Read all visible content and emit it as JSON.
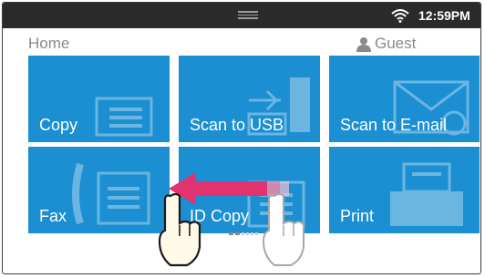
{
  "status_bar": {
    "time": "12:59PM",
    "wifi_icon": "wifi-icon",
    "handle_icon": "drag-handle-icon"
  },
  "header": {
    "title": "Home",
    "user_label": "Guest",
    "user_icon": "person-icon"
  },
  "tiles": [
    {
      "label": "Copy",
      "icon": "copy-icon"
    },
    {
      "label": "Scan to USB",
      "icon": "usb-icon"
    },
    {
      "label": "Scan to E-mail",
      "icon": "email-icon"
    },
    {
      "label": "Fax",
      "icon": "fax-icon"
    },
    {
      "label": "ID Copy",
      "icon": "id-copy-icon"
    },
    {
      "label": "Print",
      "icon": "print-icon"
    }
  ],
  "gesture": {
    "direction": "swipe-left",
    "arrow_color": "#e2336f",
    "hand_icon": "pointing-hand-icon"
  },
  "pager": {
    "pages": 2,
    "current": 1
  },
  "colors": {
    "tile": "#1b8fd2",
    "status_bar": "#2b2b2b",
    "header_text": "#8a8a8a"
  }
}
